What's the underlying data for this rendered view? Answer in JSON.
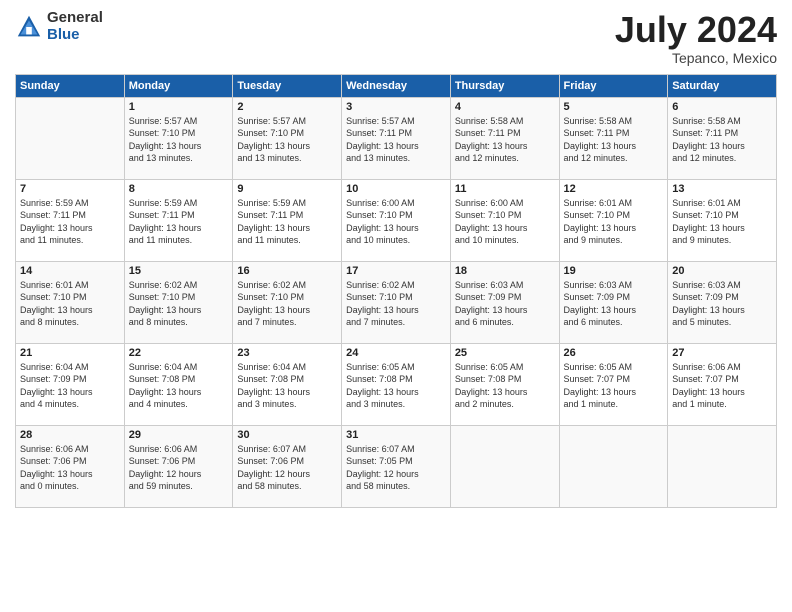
{
  "header": {
    "logo_general": "General",
    "logo_blue": "Blue",
    "month_title": "July 2024",
    "location": "Tepanco, Mexico"
  },
  "days_of_week": [
    "Sunday",
    "Monday",
    "Tuesday",
    "Wednesday",
    "Thursday",
    "Friday",
    "Saturday"
  ],
  "weeks": [
    [
      {
        "day": "",
        "info": ""
      },
      {
        "day": "1",
        "info": "Sunrise: 5:57 AM\nSunset: 7:10 PM\nDaylight: 13 hours\nand 13 minutes."
      },
      {
        "day": "2",
        "info": "Sunrise: 5:57 AM\nSunset: 7:10 PM\nDaylight: 13 hours\nand 13 minutes."
      },
      {
        "day": "3",
        "info": "Sunrise: 5:57 AM\nSunset: 7:11 PM\nDaylight: 13 hours\nand 13 minutes."
      },
      {
        "day": "4",
        "info": "Sunrise: 5:58 AM\nSunset: 7:11 PM\nDaylight: 13 hours\nand 12 minutes."
      },
      {
        "day": "5",
        "info": "Sunrise: 5:58 AM\nSunset: 7:11 PM\nDaylight: 13 hours\nand 12 minutes."
      },
      {
        "day": "6",
        "info": "Sunrise: 5:58 AM\nSunset: 7:11 PM\nDaylight: 13 hours\nand 12 minutes."
      }
    ],
    [
      {
        "day": "7",
        "info": "Sunrise: 5:59 AM\nSunset: 7:11 PM\nDaylight: 13 hours\nand 11 minutes."
      },
      {
        "day": "8",
        "info": "Sunrise: 5:59 AM\nSunset: 7:11 PM\nDaylight: 13 hours\nand 11 minutes."
      },
      {
        "day": "9",
        "info": "Sunrise: 5:59 AM\nSunset: 7:11 PM\nDaylight: 13 hours\nand 11 minutes."
      },
      {
        "day": "10",
        "info": "Sunrise: 6:00 AM\nSunset: 7:10 PM\nDaylight: 13 hours\nand 10 minutes."
      },
      {
        "day": "11",
        "info": "Sunrise: 6:00 AM\nSunset: 7:10 PM\nDaylight: 13 hours\nand 10 minutes."
      },
      {
        "day": "12",
        "info": "Sunrise: 6:01 AM\nSunset: 7:10 PM\nDaylight: 13 hours\nand 9 minutes."
      },
      {
        "day": "13",
        "info": "Sunrise: 6:01 AM\nSunset: 7:10 PM\nDaylight: 13 hours\nand 9 minutes."
      }
    ],
    [
      {
        "day": "14",
        "info": "Sunrise: 6:01 AM\nSunset: 7:10 PM\nDaylight: 13 hours\nand 8 minutes."
      },
      {
        "day": "15",
        "info": "Sunrise: 6:02 AM\nSunset: 7:10 PM\nDaylight: 13 hours\nand 8 minutes."
      },
      {
        "day": "16",
        "info": "Sunrise: 6:02 AM\nSunset: 7:10 PM\nDaylight: 13 hours\nand 7 minutes."
      },
      {
        "day": "17",
        "info": "Sunrise: 6:02 AM\nSunset: 7:10 PM\nDaylight: 13 hours\nand 7 minutes."
      },
      {
        "day": "18",
        "info": "Sunrise: 6:03 AM\nSunset: 7:09 PM\nDaylight: 13 hours\nand 6 minutes."
      },
      {
        "day": "19",
        "info": "Sunrise: 6:03 AM\nSunset: 7:09 PM\nDaylight: 13 hours\nand 6 minutes."
      },
      {
        "day": "20",
        "info": "Sunrise: 6:03 AM\nSunset: 7:09 PM\nDaylight: 13 hours\nand 5 minutes."
      }
    ],
    [
      {
        "day": "21",
        "info": "Sunrise: 6:04 AM\nSunset: 7:09 PM\nDaylight: 13 hours\nand 4 minutes."
      },
      {
        "day": "22",
        "info": "Sunrise: 6:04 AM\nSunset: 7:08 PM\nDaylight: 13 hours\nand 4 minutes."
      },
      {
        "day": "23",
        "info": "Sunrise: 6:04 AM\nSunset: 7:08 PM\nDaylight: 13 hours\nand 3 minutes."
      },
      {
        "day": "24",
        "info": "Sunrise: 6:05 AM\nSunset: 7:08 PM\nDaylight: 13 hours\nand 3 minutes."
      },
      {
        "day": "25",
        "info": "Sunrise: 6:05 AM\nSunset: 7:08 PM\nDaylight: 13 hours\nand 2 minutes."
      },
      {
        "day": "26",
        "info": "Sunrise: 6:05 AM\nSunset: 7:07 PM\nDaylight: 13 hours\nand 1 minute."
      },
      {
        "day": "27",
        "info": "Sunrise: 6:06 AM\nSunset: 7:07 PM\nDaylight: 13 hours\nand 1 minute."
      }
    ],
    [
      {
        "day": "28",
        "info": "Sunrise: 6:06 AM\nSunset: 7:06 PM\nDaylight: 13 hours\nand 0 minutes."
      },
      {
        "day": "29",
        "info": "Sunrise: 6:06 AM\nSunset: 7:06 PM\nDaylight: 12 hours\nand 59 minutes."
      },
      {
        "day": "30",
        "info": "Sunrise: 6:07 AM\nSunset: 7:06 PM\nDaylight: 12 hours\nand 58 minutes."
      },
      {
        "day": "31",
        "info": "Sunrise: 6:07 AM\nSunset: 7:05 PM\nDaylight: 12 hours\nand 58 minutes."
      },
      {
        "day": "",
        "info": ""
      },
      {
        "day": "",
        "info": ""
      },
      {
        "day": "",
        "info": ""
      }
    ]
  ]
}
